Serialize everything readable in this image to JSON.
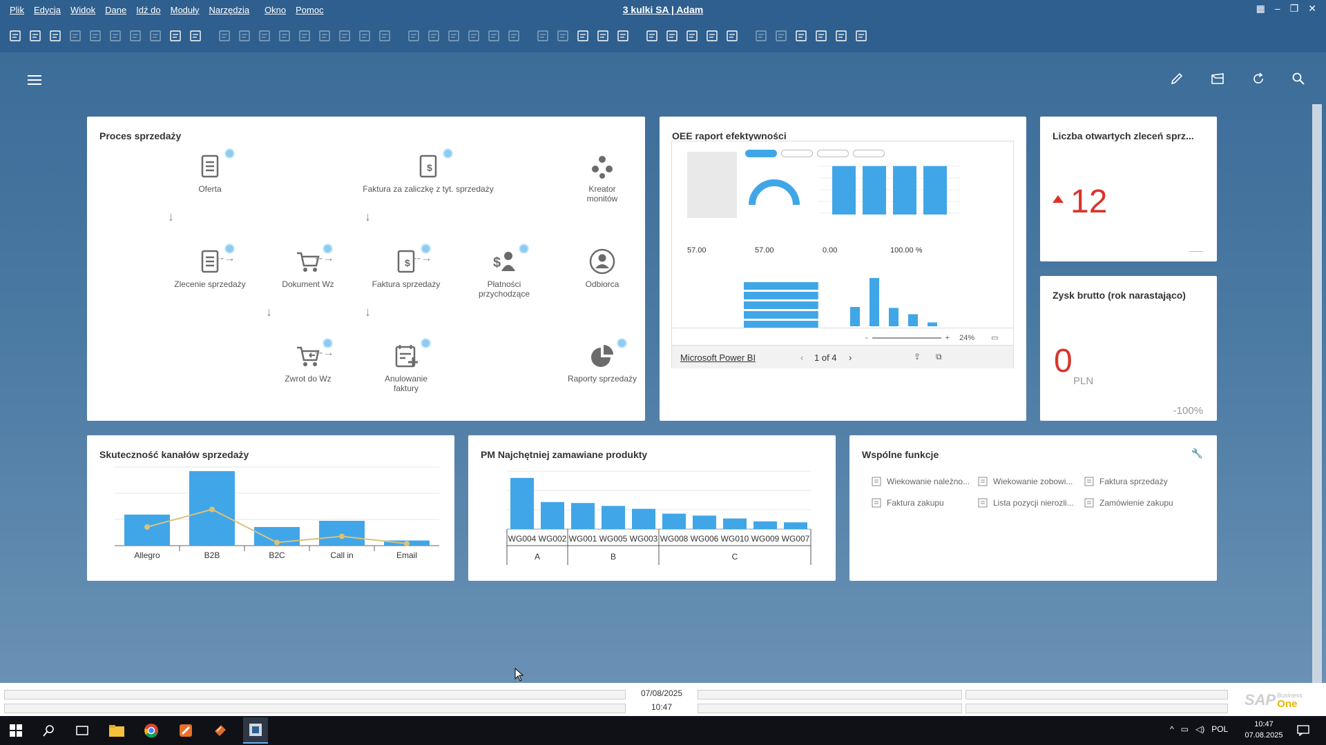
{
  "menu": {
    "items": [
      "Plik",
      "Edycja",
      "Widok",
      "Dane",
      "Idź do",
      "Moduły",
      "Narzędzia",
      "Okno",
      "Pomoc"
    ],
    "title": "3 kulki SA | Adam"
  },
  "sales_process": {
    "title": "Proces sprzedaży",
    "nodes": {
      "offer": "Oferta",
      "downpayment": "Faktura za zaliczkę z tyt. sprzedaży",
      "monitor_wizard": "Kreator monitów",
      "order": "Zlecenie sprzedaży",
      "delivery": "Dokument Wz",
      "invoice": "Faktura sprzedaży",
      "payments": "Płatności przychodzące",
      "customer": "Odbiorca",
      "return": "Zwrot do Wz",
      "cancel_invoice": "Anulowanie faktury",
      "reports": "Raporty sprzedaży"
    }
  },
  "oee": {
    "title": "OEE raport efektywności",
    "gauge": "100.00 %",
    "kpis": [
      "57.00",
      "57.00",
      "0.00",
      "100.00 %"
    ],
    "zoom": "24%",
    "link": "Microsoft Power BI",
    "pages": "1 of 4",
    "bar_heights": [
      0.95,
      0.95,
      0.95,
      0.95
    ],
    "hbar_fractions": [
      0.98,
      0.98,
      0.98,
      0.98,
      0.98
    ],
    "vbar_heights": [
      0.4,
      1.0,
      0.38,
      0.25,
      0.08
    ]
  },
  "open_orders": {
    "title": "Liczba otwartych zleceń sprz...",
    "value": "12",
    "trend": "up"
  },
  "gross_profit": {
    "title": "Zysk brutto (rok narastająco)",
    "value": "0",
    "unit": "PLN",
    "change": "-100%"
  },
  "channels": {
    "title": "Skuteczność kanałów sprzedaży"
  },
  "top_products": {
    "title": "PM Najchętniej zamawiane produkty"
  },
  "common": {
    "title": "Wspólne funkcje",
    "items": [
      "Wiekowanie należno...",
      "Wiekowanie zobowi...",
      "Faktura sprzedaży",
      "Faktura zakupu",
      "Lista pozycji nierozli...",
      "Zamówienie zakupu"
    ]
  },
  "status": {
    "date": "07/08/2025",
    "time": "10:47"
  },
  "sap": {
    "brand": "SAP",
    "sub1": "Business",
    "sub2": "One"
  },
  "taskbar": {
    "lang": "POL",
    "time": "10:47",
    "date": "07.08.2025"
  },
  "colors": {
    "accent": "#41a6e8",
    "negative": "#d9342b",
    "line": "#d9c27a",
    "header": "#2e5f8e"
  },
  "chart_data": [
    {
      "type": "bar",
      "categories": [
        "Allegro",
        "B2B",
        "B2C",
        "Call in",
        "Email"
      ],
      "series": [
        {
          "type": "bar",
          "values": [
            30,
            72,
            18,
            24,
            5
          ]
        },
        {
          "type": "line",
          "values": [
            18,
            35,
            3,
            9,
            2
          ]
        }
      ],
      "ylim": [
        0,
        80
      ],
      "grid": true
    },
    {
      "type": "bar",
      "categories": [
        "WG004",
        "WG002",
        "WG001",
        "WG005",
        "WG003",
        "WG008",
        "WG006",
        "WG010",
        "WG009",
        "WG007"
      ],
      "groups": [
        {
          "label": "A",
          "categories": [
            "WG004",
            "WG002"
          ]
        },
        {
          "label": "B",
          "categories": [
            "WG001",
            "WG005",
            "WG003"
          ]
        },
        {
          "label": "C",
          "categories": [
            "WG008",
            "WG006",
            "WG010",
            "WG009",
            "WG007"
          ]
        }
      ],
      "values": [
        53,
        28,
        27,
        24,
        21,
        16,
        14,
        11,
        8,
        7
      ],
      "ylim": [
        0,
        60
      ],
      "grid": true
    }
  ]
}
